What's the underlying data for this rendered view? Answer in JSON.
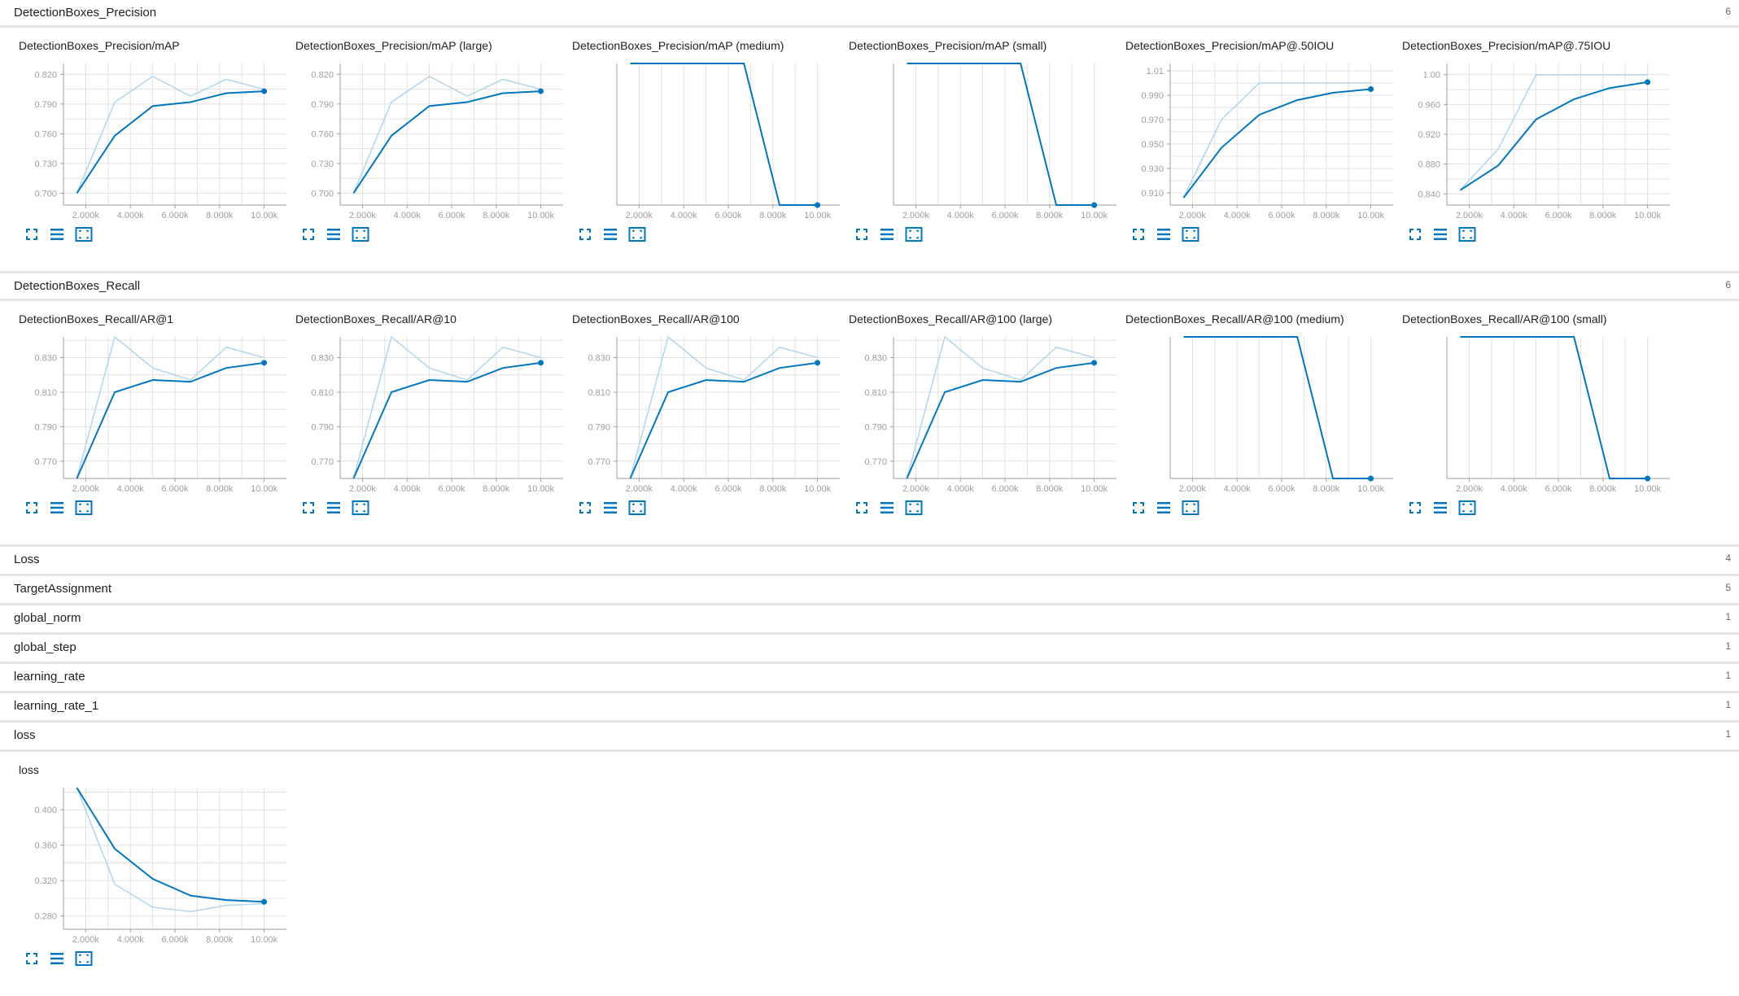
{
  "colors": {
    "accent": "#0277bd",
    "smooth_raw": "#b3d5ea",
    "grid": "#e0e0e0",
    "divider": "#e4e4e4"
  },
  "icons": [
    "fullscreen-icon",
    "data-list-icon",
    "fit-domain-icon"
  ],
  "sections": [
    {
      "title": "DetectionBoxes_Precision",
      "count": "6",
      "expanded": true
    },
    {
      "title": "DetectionBoxes_Recall",
      "count": "6",
      "expanded": true
    },
    {
      "title": "Loss",
      "count": "4",
      "expanded": false
    },
    {
      "title": "TargetAssignment",
      "count": "5",
      "expanded": false
    },
    {
      "title": "global_norm",
      "count": "1",
      "expanded": false
    },
    {
      "title": "global_step",
      "count": "1",
      "expanded": false
    },
    {
      "title": "learning_rate",
      "count": "1",
      "expanded": false
    },
    {
      "title": "learning_rate_1",
      "count": "1",
      "expanded": false
    },
    {
      "title": "loss",
      "count": "1",
      "expanded": true
    }
  ],
  "chart_data": [
    {
      "type": "line",
      "title": "DetectionBoxes_Precision/mAP",
      "x": [
        1.6,
        3.3,
        5,
        6.7,
        8.3,
        10
      ],
      "xlim": [
        1,
        11
      ],
      "xticks": [
        "2.000k",
        "4.000k",
        "6.000k",
        "8.000k",
        "10.00k"
      ],
      "ylim": [
        0.688,
        0.831
      ],
      "yticks": [
        "0.700",
        "0.730",
        "0.760",
        "0.790",
        "0.820"
      ],
      "series": [
        {
          "role": "raw",
          "values": [
            0.7,
            0.792,
            0.818,
            0.798,
            0.815,
            0.805
          ]
        },
        {
          "role": "smoothed",
          "values": [
            0.7,
            0.758,
            0.788,
            0.792,
            0.801,
            0.803
          ]
        }
      ]
    },
    {
      "type": "line",
      "title": "DetectionBoxes_Precision/mAP (large)",
      "x": [
        1.6,
        3.3,
        5,
        6.7,
        8.3,
        10
      ],
      "xlim": [
        1,
        11
      ],
      "xticks": [
        "2.000k",
        "4.000k",
        "6.000k",
        "8.000k",
        "10.00k"
      ],
      "ylim": [
        0.688,
        0.831
      ],
      "yticks": [
        "0.700",
        "0.730",
        "0.760",
        "0.790",
        "0.820"
      ],
      "series": [
        {
          "role": "raw",
          "values": [
            0.7,
            0.792,
            0.818,
            0.798,
            0.815,
            0.805
          ]
        },
        {
          "role": "smoothed",
          "values": [
            0.7,
            0.758,
            0.788,
            0.792,
            0.801,
            0.803
          ]
        }
      ]
    },
    {
      "type": "line",
      "title": "DetectionBoxes_Precision/mAP (medium)",
      "x": [
        1.6,
        3.3,
        5,
        6.7,
        8.3,
        10
      ],
      "xlim": [
        1,
        11
      ],
      "xticks": [
        "2.000k",
        "4.000k",
        "6.000k",
        "8.000k",
        "10.00k"
      ],
      "ylim": [
        -1,
        -0.35
      ],
      "yticks": [],
      "series": [
        {
          "role": "raw",
          "values": [
            -0.35,
            -0.35,
            -0.35,
            -0.35,
            -1,
            -1
          ]
        },
        {
          "role": "smoothed",
          "values": [
            -0.35,
            -0.35,
            -0.35,
            -0.35,
            -1,
            -1
          ]
        }
      ]
    },
    {
      "type": "line",
      "title": "DetectionBoxes_Precision/mAP (small)",
      "x": [
        1.6,
        3.3,
        5,
        6.7,
        8.3,
        10
      ],
      "xlim": [
        1,
        11
      ],
      "xticks": [
        "2.000k",
        "4.000k",
        "6.000k",
        "8.000k",
        "10.00k"
      ],
      "ylim": [
        -1,
        -0.35
      ],
      "yticks": [],
      "series": [
        {
          "role": "raw",
          "values": [
            -0.35,
            -0.35,
            -0.35,
            -0.35,
            -1,
            -1
          ]
        },
        {
          "role": "smoothed",
          "values": [
            -0.35,
            -0.35,
            -0.35,
            -0.35,
            -1,
            -1
          ]
        }
      ]
    },
    {
      "type": "line",
      "title": "DetectionBoxes_Precision/mAP@.50IOU",
      "x": [
        1.6,
        3.3,
        5,
        6.7,
        8.3,
        10
      ],
      "xlim": [
        1,
        11
      ],
      "xticks": [
        "2.000k",
        "4.000k",
        "6.000k",
        "8.000k",
        "10.00k"
      ],
      "ylim": [
        0.9,
        1.016
      ],
      "yticks": [
        "0.910",
        "0.930",
        "0.950",
        "0.970",
        "0.990",
        "1.01"
      ],
      "series": [
        {
          "role": "raw",
          "values": [
            0.906,
            0.97,
            1.0,
            1.0,
            1.0,
            1.0
          ]
        },
        {
          "role": "smoothed",
          "values": [
            0.906,
            0.947,
            0.974,
            0.986,
            0.992,
            0.995
          ]
        }
      ]
    },
    {
      "type": "line",
      "title": "DetectionBoxes_Precision/mAP@.75IOU",
      "x": [
        1.6,
        3.3,
        5,
        6.7,
        8.3,
        10
      ],
      "xlim": [
        1,
        11
      ],
      "xticks": [
        "2.000k",
        "4.000k",
        "6.000k",
        "8.000k",
        "10.00k"
      ],
      "ylim": [
        0.825,
        1.015
      ],
      "yticks": [
        "0.840",
        "0.880",
        "0.920",
        "0.960",
        "1.00"
      ],
      "series": [
        {
          "role": "raw",
          "values": [
            0.845,
            0.9,
            1.0,
            1.0,
            1.0,
            1.0
          ]
        },
        {
          "role": "smoothed",
          "values": [
            0.845,
            0.878,
            0.94,
            0.967,
            0.982,
            0.99
          ]
        }
      ]
    },
    {
      "type": "line",
      "title": "DetectionBoxes_Recall/AR@1",
      "x": [
        1.6,
        3.3,
        5,
        6.7,
        8.3,
        10
      ],
      "xlim": [
        1,
        11
      ],
      "xticks": [
        "2.000k",
        "4.000k",
        "6.000k",
        "8.000k",
        "10.00k"
      ],
      "ylim": [
        0.76,
        0.842
      ],
      "yticks": [
        "0.770",
        "0.790",
        "0.810",
        "0.830"
      ],
      "series": [
        {
          "role": "raw",
          "values": [
            0.76,
            0.842,
            0.824,
            0.817,
            0.836,
            0.83
          ]
        },
        {
          "role": "smoothed",
          "values": [
            0.76,
            0.81,
            0.817,
            0.816,
            0.824,
            0.827
          ]
        }
      ]
    },
    {
      "type": "line",
      "title": "DetectionBoxes_Recall/AR@10",
      "x": [
        1.6,
        3.3,
        5,
        6.7,
        8.3,
        10
      ],
      "xlim": [
        1,
        11
      ],
      "xticks": [
        "2.000k",
        "4.000k",
        "6.000k",
        "8.000k",
        "10.00k"
      ],
      "ylim": [
        0.76,
        0.842
      ],
      "yticks": [
        "0.770",
        "0.790",
        "0.810",
        "0.830"
      ],
      "series": [
        {
          "role": "raw",
          "values": [
            0.76,
            0.842,
            0.824,
            0.817,
            0.836,
            0.83
          ]
        },
        {
          "role": "smoothed",
          "values": [
            0.76,
            0.81,
            0.817,
            0.816,
            0.824,
            0.827
          ]
        }
      ]
    },
    {
      "type": "line",
      "title": "DetectionBoxes_Recall/AR@100",
      "x": [
        1.6,
        3.3,
        5,
        6.7,
        8.3,
        10
      ],
      "xlim": [
        1,
        11
      ],
      "xticks": [
        "2.000k",
        "4.000k",
        "6.000k",
        "8.000k",
        "10.00k"
      ],
      "ylim": [
        0.76,
        0.842
      ],
      "yticks": [
        "0.770",
        "0.790",
        "0.810",
        "0.830"
      ],
      "series": [
        {
          "role": "raw",
          "values": [
            0.76,
            0.842,
            0.824,
            0.817,
            0.836,
            0.83
          ]
        },
        {
          "role": "smoothed",
          "values": [
            0.76,
            0.81,
            0.817,
            0.816,
            0.824,
            0.827
          ]
        }
      ]
    },
    {
      "type": "line",
      "title": "DetectionBoxes_Recall/AR@100 (large)",
      "x": [
        1.6,
        3.3,
        5,
        6.7,
        8.3,
        10
      ],
      "xlim": [
        1,
        11
      ],
      "xticks": [
        "2.000k",
        "4.000k",
        "6.000k",
        "8.000k",
        "10.00k"
      ],
      "ylim": [
        0.76,
        0.842
      ],
      "yticks": [
        "0.770",
        "0.790",
        "0.810",
        "0.830"
      ],
      "series": [
        {
          "role": "raw",
          "values": [
            0.76,
            0.842,
            0.824,
            0.817,
            0.836,
            0.83
          ]
        },
        {
          "role": "smoothed",
          "values": [
            0.76,
            0.81,
            0.817,
            0.816,
            0.824,
            0.827
          ]
        }
      ]
    },
    {
      "type": "line",
      "title": "DetectionBoxes_Recall/AR@100 (medium)",
      "x": [
        1.6,
        3.3,
        5,
        6.7,
        8.3,
        10
      ],
      "xlim": [
        1,
        11
      ],
      "xticks": [
        "2.000k",
        "4.000k",
        "6.000k",
        "8.000k",
        "10.00k"
      ],
      "ylim": [
        -1,
        -0.35
      ],
      "yticks": [],
      "series": [
        {
          "role": "raw",
          "values": [
            -0.35,
            -0.35,
            -0.35,
            -0.35,
            -1,
            -1
          ]
        },
        {
          "role": "smoothed",
          "values": [
            -0.35,
            -0.35,
            -0.35,
            -0.35,
            -1,
            -1
          ]
        }
      ]
    },
    {
      "type": "line",
      "title": "DetectionBoxes_Recall/AR@100 (small)",
      "x": [
        1.6,
        3.3,
        5,
        6.7,
        8.3,
        10
      ],
      "xlim": [
        1,
        11
      ],
      "xticks": [
        "2.000k",
        "4.000k",
        "6.000k",
        "8.000k",
        "10.00k"
      ],
      "ylim": [
        -1,
        -0.35
      ],
      "yticks": [],
      "series": [
        {
          "role": "raw",
          "values": [
            -0.35,
            -0.35,
            -0.35,
            -0.35,
            -1,
            -1
          ]
        },
        {
          "role": "smoothed",
          "values": [
            -0.35,
            -0.35,
            -0.35,
            -0.35,
            -1,
            -1
          ]
        }
      ]
    },
    {
      "type": "line",
      "title": "loss",
      "x": [
        1.6,
        3.3,
        5,
        6.7,
        8.3,
        10
      ],
      "xlim": [
        1,
        11
      ],
      "xticks": [
        "2.000k",
        "4.000k",
        "6.000k",
        "8.000k",
        "10.00k"
      ],
      "ylim": [
        0.265,
        0.425
      ],
      "yticks": [
        "0.280",
        "0.320",
        "0.360",
        "0.400"
      ],
      "series": [
        {
          "role": "raw",
          "values": [
            0.425,
            0.316,
            0.29,
            0.285,
            0.292,
            0.294
          ]
        },
        {
          "role": "smoothed",
          "values": [
            0.425,
            0.356,
            0.322,
            0.303,
            0.298,
            0.296
          ]
        }
      ]
    }
  ]
}
